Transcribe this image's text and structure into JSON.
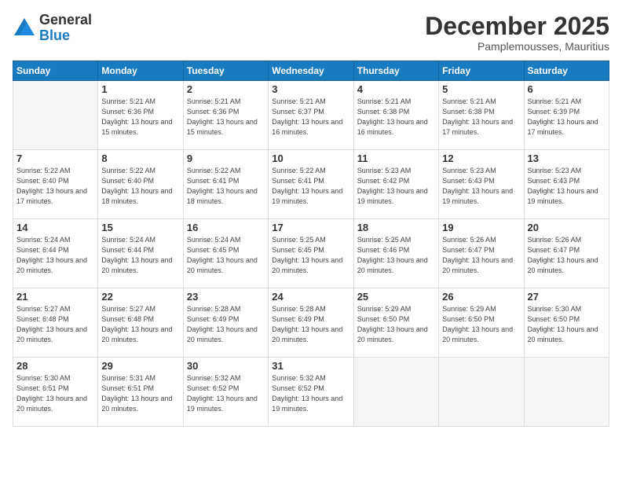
{
  "logo": {
    "general": "General",
    "blue": "Blue"
  },
  "header": {
    "month": "December 2025",
    "location": "Pamplemousses, Mauritius"
  },
  "days_of_week": [
    "Sunday",
    "Monday",
    "Tuesday",
    "Wednesday",
    "Thursday",
    "Friday",
    "Saturday"
  ],
  "weeks": [
    [
      {
        "day": null,
        "sunrise": null,
        "sunset": null,
        "daylight": null
      },
      {
        "day": "1",
        "sunrise": "Sunrise: 5:21 AM",
        "sunset": "Sunset: 6:36 PM",
        "daylight": "Daylight: 13 hours and 15 minutes."
      },
      {
        "day": "2",
        "sunrise": "Sunrise: 5:21 AM",
        "sunset": "Sunset: 6:36 PM",
        "daylight": "Daylight: 13 hours and 15 minutes."
      },
      {
        "day": "3",
        "sunrise": "Sunrise: 5:21 AM",
        "sunset": "Sunset: 6:37 PM",
        "daylight": "Daylight: 13 hours and 16 minutes."
      },
      {
        "day": "4",
        "sunrise": "Sunrise: 5:21 AM",
        "sunset": "Sunset: 6:38 PM",
        "daylight": "Daylight: 13 hours and 16 minutes."
      },
      {
        "day": "5",
        "sunrise": "Sunrise: 5:21 AM",
        "sunset": "Sunset: 6:38 PM",
        "daylight": "Daylight: 13 hours and 17 minutes."
      },
      {
        "day": "6",
        "sunrise": "Sunrise: 5:21 AM",
        "sunset": "Sunset: 6:39 PM",
        "daylight": "Daylight: 13 hours and 17 minutes."
      }
    ],
    [
      {
        "day": "7",
        "sunrise": "Sunrise: 5:22 AM",
        "sunset": "Sunset: 6:40 PM",
        "daylight": "Daylight: 13 hours and 17 minutes."
      },
      {
        "day": "8",
        "sunrise": "Sunrise: 5:22 AM",
        "sunset": "Sunset: 6:40 PM",
        "daylight": "Daylight: 13 hours and 18 minutes."
      },
      {
        "day": "9",
        "sunrise": "Sunrise: 5:22 AM",
        "sunset": "Sunset: 6:41 PM",
        "daylight": "Daylight: 13 hours and 18 minutes."
      },
      {
        "day": "10",
        "sunrise": "Sunrise: 5:22 AM",
        "sunset": "Sunset: 6:41 PM",
        "daylight": "Daylight: 13 hours and 19 minutes."
      },
      {
        "day": "11",
        "sunrise": "Sunrise: 5:23 AM",
        "sunset": "Sunset: 6:42 PM",
        "daylight": "Daylight: 13 hours and 19 minutes."
      },
      {
        "day": "12",
        "sunrise": "Sunrise: 5:23 AM",
        "sunset": "Sunset: 6:43 PM",
        "daylight": "Daylight: 13 hours and 19 minutes."
      },
      {
        "day": "13",
        "sunrise": "Sunrise: 5:23 AM",
        "sunset": "Sunset: 6:43 PM",
        "daylight": "Daylight: 13 hours and 19 minutes."
      }
    ],
    [
      {
        "day": "14",
        "sunrise": "Sunrise: 5:24 AM",
        "sunset": "Sunset: 6:44 PM",
        "daylight": "Daylight: 13 hours and 20 minutes."
      },
      {
        "day": "15",
        "sunrise": "Sunrise: 5:24 AM",
        "sunset": "Sunset: 6:44 PM",
        "daylight": "Daylight: 13 hours and 20 minutes."
      },
      {
        "day": "16",
        "sunrise": "Sunrise: 5:24 AM",
        "sunset": "Sunset: 6:45 PM",
        "daylight": "Daylight: 13 hours and 20 minutes."
      },
      {
        "day": "17",
        "sunrise": "Sunrise: 5:25 AM",
        "sunset": "Sunset: 6:45 PM",
        "daylight": "Daylight: 13 hours and 20 minutes."
      },
      {
        "day": "18",
        "sunrise": "Sunrise: 5:25 AM",
        "sunset": "Sunset: 6:46 PM",
        "daylight": "Daylight: 13 hours and 20 minutes."
      },
      {
        "day": "19",
        "sunrise": "Sunrise: 5:26 AM",
        "sunset": "Sunset: 6:47 PM",
        "daylight": "Daylight: 13 hours and 20 minutes."
      },
      {
        "day": "20",
        "sunrise": "Sunrise: 5:26 AM",
        "sunset": "Sunset: 6:47 PM",
        "daylight": "Daylight: 13 hours and 20 minutes."
      }
    ],
    [
      {
        "day": "21",
        "sunrise": "Sunrise: 5:27 AM",
        "sunset": "Sunset: 6:48 PM",
        "daylight": "Daylight: 13 hours and 20 minutes."
      },
      {
        "day": "22",
        "sunrise": "Sunrise: 5:27 AM",
        "sunset": "Sunset: 6:48 PM",
        "daylight": "Daylight: 13 hours and 20 minutes."
      },
      {
        "day": "23",
        "sunrise": "Sunrise: 5:28 AM",
        "sunset": "Sunset: 6:49 PM",
        "daylight": "Daylight: 13 hours and 20 minutes."
      },
      {
        "day": "24",
        "sunrise": "Sunrise: 5:28 AM",
        "sunset": "Sunset: 6:49 PM",
        "daylight": "Daylight: 13 hours and 20 minutes."
      },
      {
        "day": "25",
        "sunrise": "Sunrise: 5:29 AM",
        "sunset": "Sunset: 6:50 PM",
        "daylight": "Daylight: 13 hours and 20 minutes."
      },
      {
        "day": "26",
        "sunrise": "Sunrise: 5:29 AM",
        "sunset": "Sunset: 6:50 PM",
        "daylight": "Daylight: 13 hours and 20 minutes."
      },
      {
        "day": "27",
        "sunrise": "Sunrise: 5:30 AM",
        "sunset": "Sunset: 6:50 PM",
        "daylight": "Daylight: 13 hours and 20 minutes."
      }
    ],
    [
      {
        "day": "28",
        "sunrise": "Sunrise: 5:30 AM",
        "sunset": "Sunset: 6:51 PM",
        "daylight": "Daylight: 13 hours and 20 minutes."
      },
      {
        "day": "29",
        "sunrise": "Sunrise: 5:31 AM",
        "sunset": "Sunset: 6:51 PM",
        "daylight": "Daylight: 13 hours and 20 minutes."
      },
      {
        "day": "30",
        "sunrise": "Sunrise: 5:32 AM",
        "sunset": "Sunset: 6:52 PM",
        "daylight": "Daylight: 13 hours and 19 minutes."
      },
      {
        "day": "31",
        "sunrise": "Sunrise: 5:32 AM",
        "sunset": "Sunset: 6:52 PM",
        "daylight": "Daylight: 13 hours and 19 minutes."
      },
      {
        "day": null,
        "sunrise": null,
        "sunset": null,
        "daylight": null
      },
      {
        "day": null,
        "sunrise": null,
        "sunset": null,
        "daylight": null
      },
      {
        "day": null,
        "sunrise": null,
        "sunset": null,
        "daylight": null
      }
    ]
  ]
}
